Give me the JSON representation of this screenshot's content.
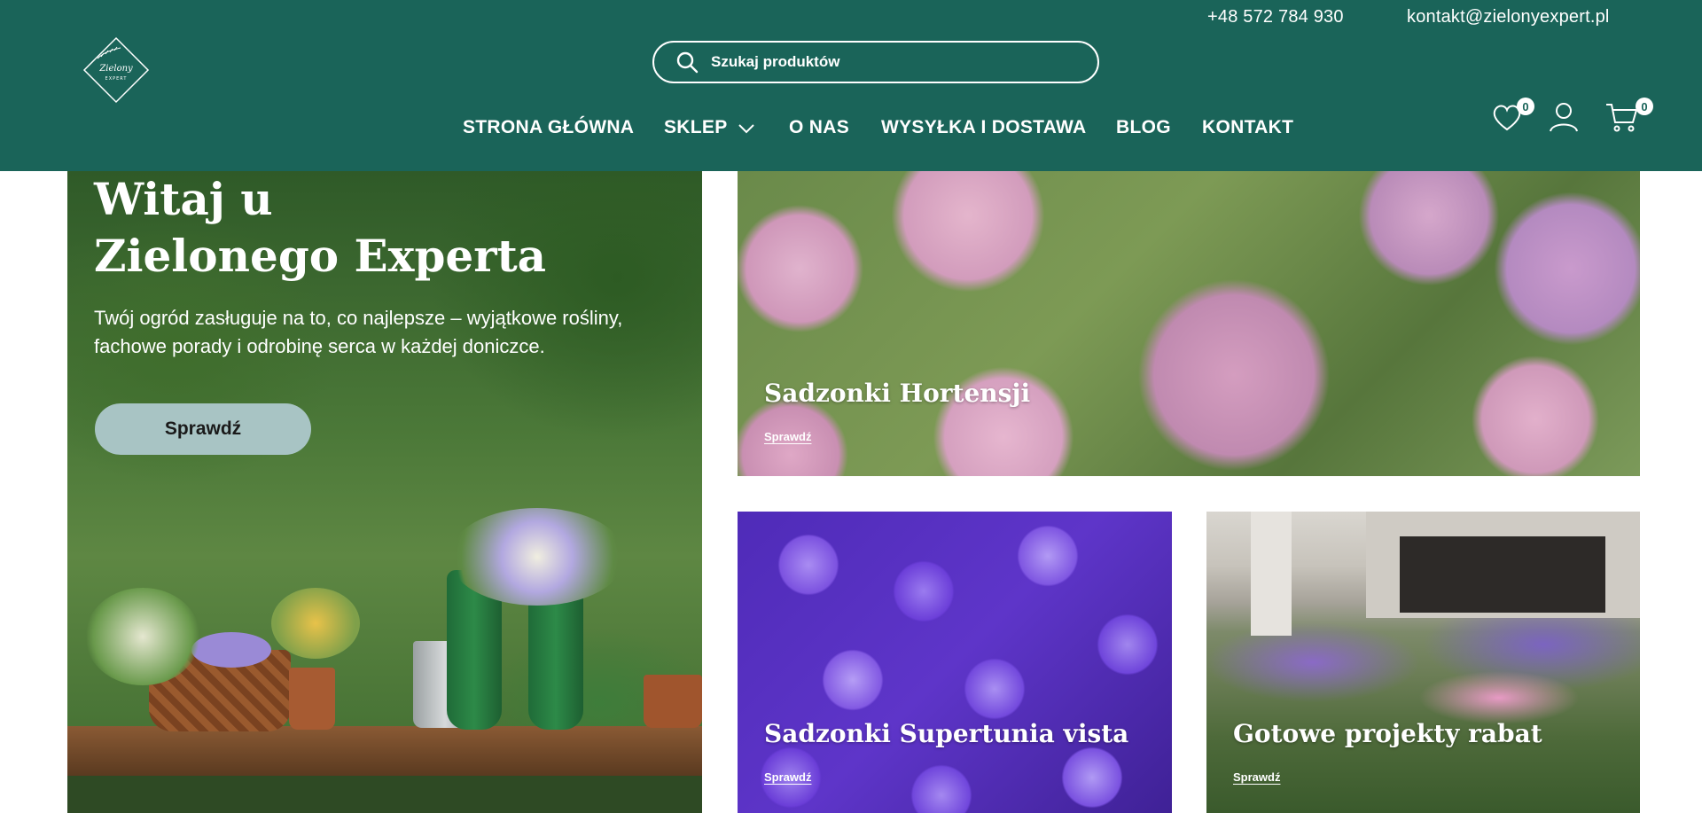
{
  "header": {
    "phone": "+48 572 784 930",
    "email": "kontakt@zielonyexpert.pl",
    "search_placeholder": "Szukaj produktów",
    "wishlist_count": "0",
    "cart_count": "0",
    "logo_text": "Zielony",
    "logo_subtext": "EXPERT"
  },
  "nav": {
    "home": "STRONA GŁÓWNA",
    "shop": "SKLEP",
    "about": "O NAS",
    "shipping": "WYSYŁKA I DOSTAWA",
    "blog": "BLOG",
    "contact": "KONTAKT"
  },
  "hero": {
    "title_line1": "Witaj u",
    "title_line2": "Zielonego Experta",
    "subtitle_line1": "Twój ogród zasługuje na to, co najlepsze – wyjątkowe rośliny,",
    "subtitle_line2": "fachowe porady i odrobinę serca w każdej doniczce.",
    "button": "Sprawdź"
  },
  "cards": [
    {
      "title": "Sadzonki Hortensji",
      "link": "Sprawdź"
    },
    {
      "title": "Sadzonki Supertunia vista",
      "link": "Sprawdź"
    },
    {
      "title": "Gotowe projekty rabat",
      "link": "Sprawdź"
    }
  ],
  "colors": {
    "header_bg": "#1a6459",
    "hero_button_bg": "#a8c4c4",
    "text_light": "#ffffff"
  },
  "icons": [
    "search-icon",
    "heart-icon",
    "user-icon",
    "cart-icon",
    "chevron-down-icon",
    "logo-leaf-icon"
  ]
}
